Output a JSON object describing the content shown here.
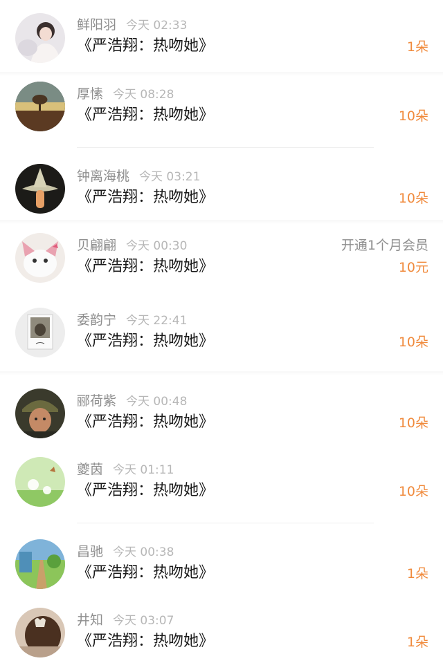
{
  "gifts": [
    {
      "name": "鲜阳羽",
      "time": "今天 02:33",
      "title": "《严浩翔：热吻她》",
      "amount": "1朵",
      "avatar": "girl-photo-avatar"
    },
    {
      "name": "厚愫",
      "time": "今天 08:28",
      "title": "《严浩翔：热吻她》",
      "amount": "10朵",
      "avatar": "sunset-tree-avatar"
    },
    {
      "name": "钟离海桃",
      "time": "今天 03:21",
      "title": "《严浩翔：热吻她》",
      "amount": "10朵",
      "avatar": "wizard-hat-avatar"
    },
    {
      "name": "贝翩翩",
      "time": "今天 00:30",
      "title": "《严浩翔：热吻她》",
      "amount": "10元",
      "extra": "开通1个月会员",
      "avatar": "cartoon-cat-avatar"
    },
    {
      "name": "委韵宁",
      "time": "今天 22:41",
      "title": "《严浩翔：热吻她》",
      "amount": "10朵",
      "avatar": "polaroid-avatar"
    },
    {
      "name": "郦荷紫",
      "time": "今天 00:48",
      "title": "《严浩翔：热吻她》",
      "amount": "10朵",
      "avatar": "soldier-avatar"
    },
    {
      "name": "夔茵",
      "time": "今天 01:11",
      "title": "《严浩翔：热吻她》",
      "amount": "10朵",
      "avatar": "dandelion-avatar"
    },
    {
      "name": "昌驰",
      "time": "今天 00:38",
      "title": "《严浩翔：热吻她》",
      "amount": "1朵",
      "avatar": "railway-avatar"
    },
    {
      "name": "井知",
      "time": "今天 03:07",
      "title": "《严浩翔：热吻她》",
      "amount": "1朵",
      "avatar": "hair-clip-avatar"
    }
  ]
}
